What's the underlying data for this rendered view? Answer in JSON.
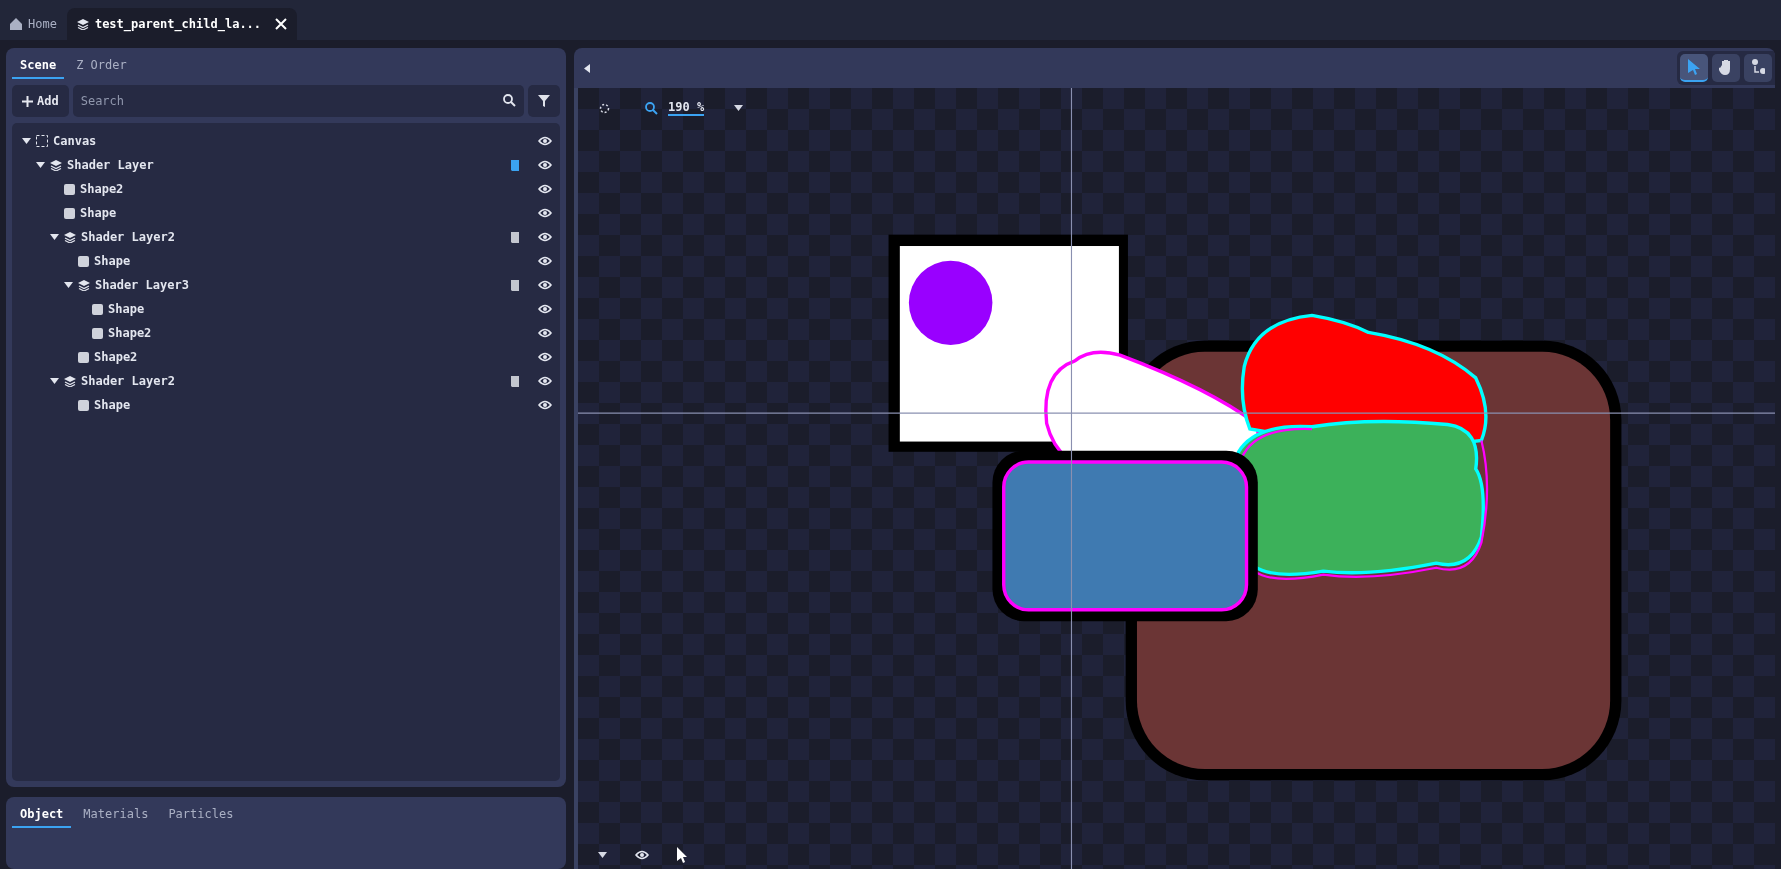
{
  "doc_tabs": [
    {
      "kind": "home",
      "label": "Home",
      "selected": false
    },
    {
      "kind": "layer",
      "label": "test_parent_child_la...",
      "selected": true,
      "closable": true
    }
  ],
  "scene_panel": {
    "tabs": [
      {
        "label": "Scene",
        "selected": true
      },
      {
        "label": "Z Order",
        "selected": false
      }
    ],
    "add_button": "Add",
    "search": {
      "placeholder": "Search"
    },
    "tree": [
      {
        "kind": "canvas",
        "label": "Canvas",
        "expanded": true,
        "visible": true,
        "children": [
          {
            "kind": "layer",
            "label": "Shader Layer",
            "expanded": true,
            "visible": true,
            "highlighted": true,
            "children": [
              {
                "kind": "shape",
                "label": "Shape2",
                "visible": true
              },
              {
                "kind": "shape",
                "label": "Shape",
                "visible": true
              },
              {
                "kind": "layer",
                "label": "Shader Layer2",
                "expanded": true,
                "visible": true,
                "highlighted": false,
                "children": [
                  {
                    "kind": "shape",
                    "label": "Shape",
                    "visible": true
                  },
                  {
                    "kind": "layer",
                    "label": "Shader Layer3",
                    "expanded": true,
                    "visible": true,
                    "highlighted": false,
                    "children": [
                      {
                        "kind": "shape",
                        "label": "Shape",
                        "visible": true
                      },
                      {
                        "kind": "shape",
                        "label": "Shape2",
                        "visible": true
                      }
                    ]
                  },
                  {
                    "kind": "shape",
                    "label": "Shape2",
                    "visible": true
                  }
                ]
              },
              {
                "kind": "layer",
                "label": "Shader Layer2",
                "expanded": true,
                "visible": true,
                "highlighted": false,
                "children": [
                  {
                    "kind": "shape",
                    "label": "Shape",
                    "visible": true
                  }
                ]
              }
            ]
          }
        ]
      }
    ]
  },
  "properties_panel": {
    "tabs": [
      {
        "label": "Object",
        "selected": true
      },
      {
        "label": "Materials",
        "selected": false
      },
      {
        "label": "Particles",
        "selected": false
      }
    ]
  },
  "viewport": {
    "tools": [
      {
        "kind": "select",
        "selected": true
      },
      {
        "kind": "pan",
        "selected": false
      },
      {
        "kind": "pivot",
        "selected": false
      }
    ],
    "zoom": "190 %"
  }
}
